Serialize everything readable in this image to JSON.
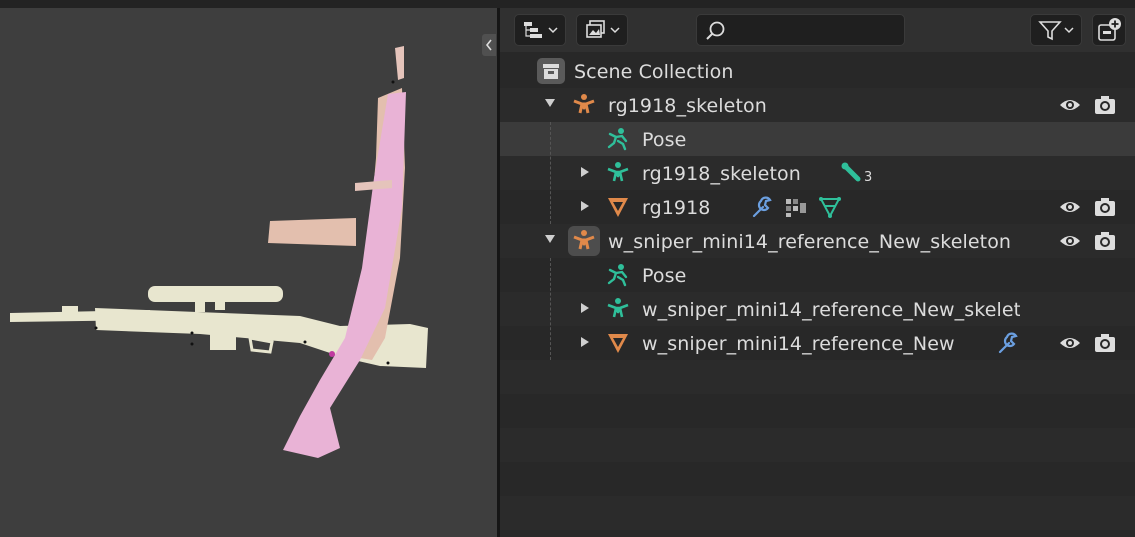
{
  "viewport": {
    "label": "3D Viewport"
  },
  "outliner": {
    "search": {
      "placeholder": ""
    },
    "rows": [
      {
        "label": "Scene Collection"
      },
      {
        "label": "rg1918_skeleton"
      },
      {
        "label": "Pose"
      },
      {
        "label": "rg1918_skeleton",
        "badge": "3"
      },
      {
        "label": "rg1918"
      },
      {
        "label": "w_sniper_mini14_reference_New_skeleton"
      },
      {
        "label": "Pose"
      },
      {
        "label": "w_sniper_mini14_reference_New_skelet"
      },
      {
        "label": "w_sniper_mini14_reference_New"
      }
    ]
  },
  "colors": {
    "armature_orange": "#e0894a",
    "pose_green": "#2fbf9a",
    "modifier_blue": "#6b9fe0",
    "highlight": "#3b3b3b"
  }
}
